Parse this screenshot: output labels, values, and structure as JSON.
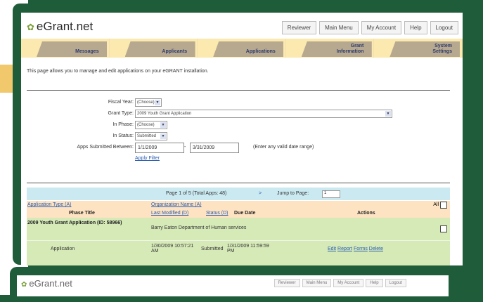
{
  "app": {
    "logo": "eGrant.net",
    "logo_icon": "leaf-icon"
  },
  "top_nav": [
    "Reviewer",
    "Main Menu",
    "My Account",
    "Help",
    "Logout"
  ],
  "tabs": [
    {
      "line1": "Messages",
      "line2": ""
    },
    {
      "line1": "Applicants",
      "line2": ""
    },
    {
      "line1": "Applications",
      "line2": ""
    },
    {
      "line1": "Grant",
      "line2": "Information"
    },
    {
      "line1": "System",
      "line2": "Settings"
    }
  ],
  "intro": "This page allows you to manage and edit applications on your eGRANT installation.",
  "filters": {
    "fiscal_year": {
      "label": "Fiscal Year:",
      "value": "(Choose)"
    },
    "grant_type": {
      "label": "Grant Type:",
      "value": "2009 Youth Grant Application"
    },
    "in_phase": {
      "label": "In Phase:",
      "value": "(Choose)"
    },
    "in_status": {
      "label": "In Status:",
      "value": "Submitted"
    },
    "apps_submitted": {
      "label": "Apps Submitted Between:",
      "from": "1/1/2009",
      "to": "3/31/2009",
      "hint": "(Enter any valid date range)"
    },
    "apply": "Apply Filter"
  },
  "pager": {
    "text": "Page 1 of 5 (Total Apps: 48)",
    "next": ">",
    "jump_label": "Jump to Page:",
    "jump_value": "1"
  },
  "table": {
    "header_row1": {
      "app_type": "Application Type (A)",
      "org_name": "Organization Name (A)",
      "all": "All"
    },
    "header_row2": {
      "phase_title": "Phase Title",
      "last_modified": "Last Modified (D)",
      "status": "Status (D)",
      "due_date": "Due Date",
      "actions": "Actions"
    },
    "group": {
      "title": "2009 Youth Grant Application (ID: 58966)",
      "org": "Barry Eaton Department of Human services"
    },
    "row": {
      "phase": "Application",
      "modified_1": "1/30/2009 10:57:21",
      "modified_2": "AM",
      "status": "Submitted",
      "due_1": "1/31/2009 11:59:59",
      "due_2": "PM",
      "edit": "Edit",
      "report": "Report",
      "forms": "Forms",
      "delete": "Delete"
    }
  },
  "second_window": {
    "logo": "eGrant.net",
    "nav": [
      "Reviewer",
      "Main Menu",
      "My Account",
      "Help",
      "Logout"
    ]
  }
}
